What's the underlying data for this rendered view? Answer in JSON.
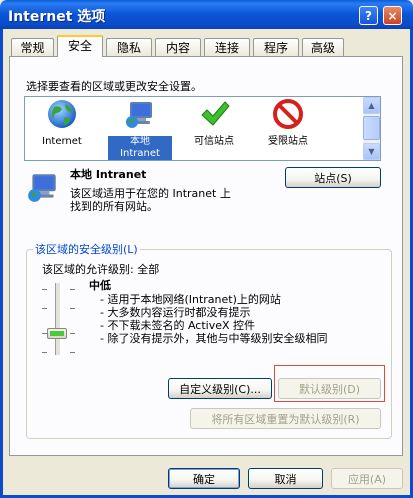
{
  "window": {
    "title": "Internet 选项",
    "help_label": "?",
    "close_label": "×"
  },
  "tabs": [
    {
      "label": "常规",
      "active": false
    },
    {
      "label": "安全",
      "active": true
    },
    {
      "label": "隐私",
      "active": false
    },
    {
      "label": "内容",
      "active": false
    },
    {
      "label": "连接",
      "active": false
    },
    {
      "label": "程序",
      "active": false
    },
    {
      "label": "高级",
      "active": false
    }
  ],
  "security": {
    "prompt": "选择要查看的区域或更改安全设置。",
    "zones": [
      {
        "label": "Internet",
        "icon": "globe-icon"
      },
      {
        "label": "本地 Intranet",
        "icon": "local-intranet-icon",
        "selected": true
      },
      {
        "label": "可信站点",
        "icon": "checkmark-icon"
      },
      {
        "label": "受限站点",
        "icon": "no-entry-icon"
      }
    ],
    "selected_zone": {
      "name": "本地  Intranet",
      "description_line1": "该区域适用于在您的 Intranet 上",
      "description_line2": "找到的所有网站。"
    },
    "sites_button": "站点(S)",
    "level_group_title": "该区域的安全级别(L)",
    "allowed_level": "该区域的允许级别: 全部",
    "level_name": "中低",
    "level_bullets": [
      "- 适用于本地网络(Intranet)上的网站",
      "- 大多数内容运行时都没有提示",
      "- 不下载未签名的 ActiveX 控件",
      "- 除了没有提示外，其他与中等级别安全级相同"
    ],
    "custom_level_button": "自定义级别(C)...",
    "default_level_button": "默认级别(D)",
    "reset_all_button": "将所有区域重置为默认级别(R)"
  },
  "footer": {
    "ok": "确定",
    "cancel": "取消",
    "apply": "应用(A)"
  },
  "colors": {
    "titlebar": "#0a54d6",
    "accent_link": "#0046d5",
    "selection": "#316ac5",
    "highlight_box": "#e04a3a"
  }
}
